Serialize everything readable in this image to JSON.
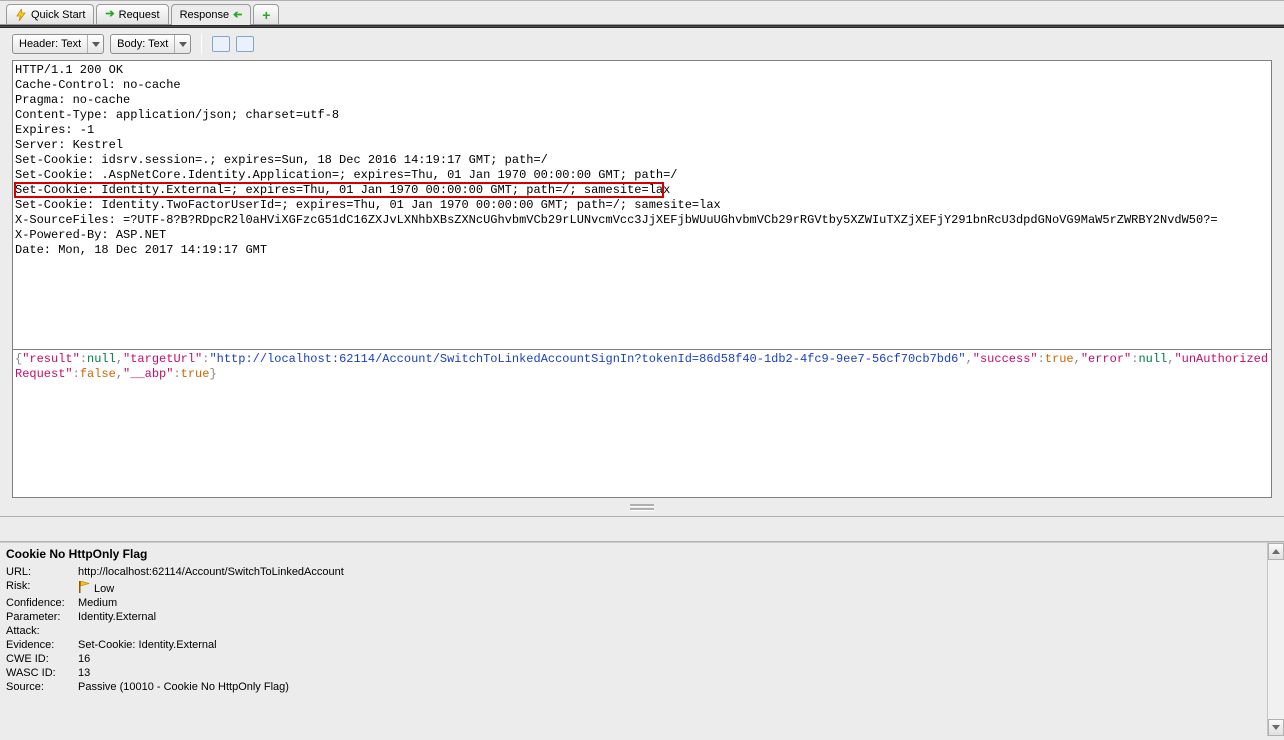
{
  "tabs": {
    "quickstart": "Quick Start",
    "request": "Request",
    "response": "Response"
  },
  "toolbar": {
    "headerMode": "Header: Text",
    "bodyMode": "Body: Text"
  },
  "response": {
    "lines": [
      "HTTP/1.1 200 OK",
      "Cache-Control: no-cache",
      "Pragma: no-cache",
      "Content-Type: application/json; charset=utf-8",
      "Expires: -1",
      "Server: Kestrel",
      "Set-Cookie: idsrv.session=.; expires=Sun, 18 Dec 2016 14:19:17 GMT; path=/",
      "Set-Cookie: .AspNetCore.Identity.Application=; expires=Thu, 01 Jan 1970 00:00:00 GMT; path=/",
      "Set-Cookie: Identity.External=; expires=Thu, 01 Jan 1970 00:00:00 GMT; path=/; samesite=lax",
      "Set-Cookie: Identity.TwoFactorUserId=; expires=Thu, 01 Jan 1970 00:00:00 GMT; path=/; samesite=lax",
      "X-SourceFiles: =?UTF-8?B?RDpcR2l0aHViXGFzcG51dC16ZXJvLXNhbXBsZXNcUGhvbmVCb29rLUNvcmVcc3JjXEFjbWUuUGhvbmVCb29rRGVtby5XZWIuTXZjXEFjY291bnRcU3dpdGNoVG9MaW5rZWRBY2NvdW50?=",
      "X-Powered-By: ASP.NET",
      "Date: Mon, 18 Dec 2017 14:19:17 GMT"
    ]
  },
  "body_json": {
    "result": null,
    "targetUrl": "http://localhost:62114/Account/SwitchToLinkedAccountSignIn?tokenId=86d58f40-1db2-4fc9-9ee7-56cf70cb7bd6",
    "success": true,
    "error": null,
    "unAuthorizedRequest": false,
    "__abp": true
  },
  "alert": {
    "title": "Cookie No HttpOnly Flag",
    "rows": {
      "url_label": "URL:",
      "url_value": "http://localhost:62114/Account/SwitchToLinkedAccount",
      "risk_label": "Risk:",
      "risk_value": "Low",
      "conf_label": "Confidence:",
      "conf_value": "Medium",
      "param_label": "Parameter:",
      "param_value": "Identity.External",
      "attack_label": "Attack:",
      "attack_value": "",
      "evidence_label": "Evidence:",
      "evidence_value": "Set-Cookie: Identity.External",
      "cwe_label": "CWE ID:",
      "cwe_value": "16",
      "wasc_label": "WASC ID:",
      "wasc_value": "13",
      "source_label": "Source:",
      "source_value": "Passive (10010 - Cookie No HttpOnly Flag)"
    }
  },
  "highlight": {
    "lineIndex": 8,
    "startCol": 0,
    "endCol": 90
  }
}
